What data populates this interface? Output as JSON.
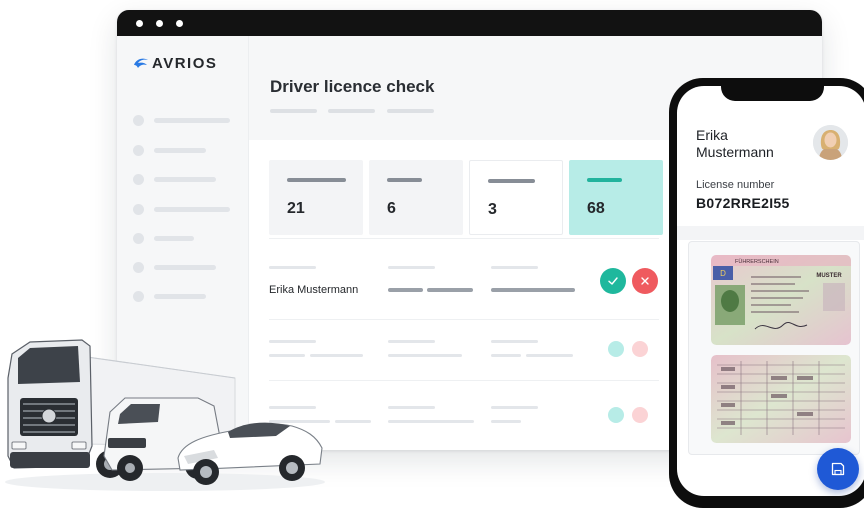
{
  "app": {
    "brand": "AVRIOS",
    "brand_color": "#2a7ae4"
  },
  "page": {
    "title": "Driver licence check"
  },
  "stats": [
    {
      "value": "21",
      "highlight": false
    },
    {
      "value": "6",
      "highlight": false
    },
    {
      "value": "3",
      "highlight": false
    },
    {
      "value": "68",
      "highlight": true
    }
  ],
  "table": {
    "rows": [
      {
        "name": "Erika Mustermann",
        "actions": [
          "approve",
          "reject"
        ]
      }
    ]
  },
  "mobile": {
    "driver_name": "Erika Mustermann",
    "license_label": "License number",
    "license_number": "B072RRE2I55",
    "license_card_front_header": "FÜHRERSCHEIN",
    "license_card_front_type": "MUSTER",
    "license_card_country": "D",
    "save_icon": "floppy-disk-icon",
    "accent_color": "#1f59d6"
  },
  "colors": {
    "approve": "#1fb89d",
    "reject": "#ef5a5f",
    "highlight_card": "#b7ece7"
  }
}
